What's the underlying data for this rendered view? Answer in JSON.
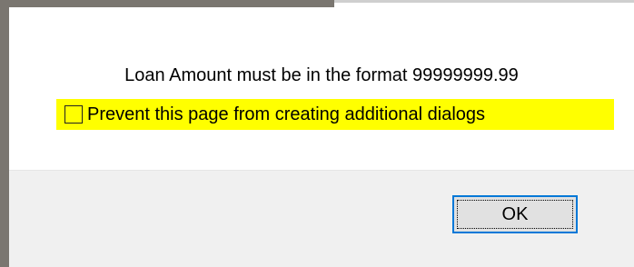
{
  "dialog": {
    "message": "Loan Amount must be in the format 99999999.99",
    "checkbox": {
      "label": "Prevent this page from creating additional dialogs",
      "checked": false,
      "highlight_color": "#ffff00"
    },
    "ok_label": "OK",
    "accent_color": "#0078d7"
  }
}
